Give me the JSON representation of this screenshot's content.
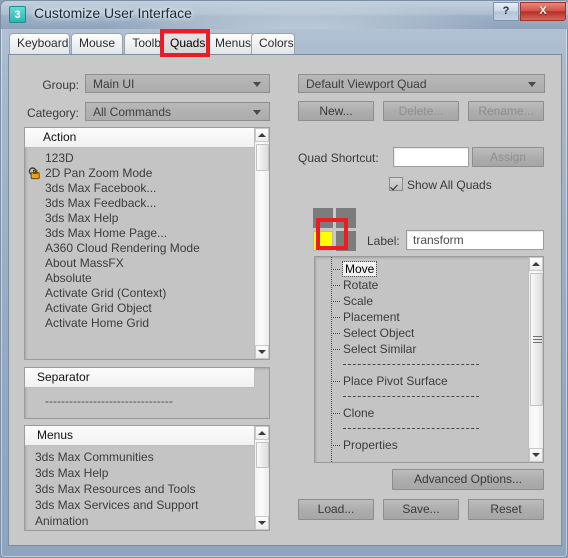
{
  "window": {
    "title": "Customize User Interface",
    "icon": "max-app-icon",
    "icon_glyph": "3",
    "buttons": {
      "help": "?",
      "close": "X"
    }
  },
  "tabs": [
    {
      "label": "Keyboard",
      "active": false
    },
    {
      "label": "Mouse",
      "active": false
    },
    {
      "label": "Toolbars",
      "active": false
    },
    {
      "label": "Quads",
      "active": true
    },
    {
      "label": "Menus",
      "active": false
    },
    {
      "label": "Colors",
      "active": false
    }
  ],
  "left": {
    "group_label": "Group:",
    "group_value": "Main UI",
    "category_label": "Category:",
    "category_value": "All Commands",
    "action_list": {
      "header": "Action",
      "items": [
        {
          "label": "123D",
          "icon": null
        },
        {
          "label": "2D Pan Zoom Mode",
          "icon": "lock-icon"
        },
        {
          "label": "3ds Max Facebook...",
          "icon": null
        },
        {
          "label": "3ds Max Feedback...",
          "icon": null
        },
        {
          "label": "3ds Max Help",
          "icon": null
        },
        {
          "label": "3ds Max Home Page...",
          "icon": null
        },
        {
          "label": "A360 Cloud Rendering Mode",
          "icon": null
        },
        {
          "label": "About MassFX",
          "icon": null
        },
        {
          "label": "Absolute",
          "icon": null
        },
        {
          "label": "Activate Grid (Context)",
          "icon": null
        },
        {
          "label": "Activate Grid Object",
          "icon": null
        },
        {
          "label": "Activate Home Grid",
          "icon": null
        }
      ]
    },
    "separator_list": {
      "header": "Separator",
      "items": [
        {
          "label": "--------------------------------"
        }
      ]
    },
    "menus_list": {
      "header": "Menus",
      "items": [
        {
          "label": "3ds Max Communities"
        },
        {
          "label": "3ds Max Help"
        },
        {
          "label": "3ds Max Resources and Tools"
        },
        {
          "label": "3ds Max Services and Support"
        },
        {
          "label": "Animation"
        }
      ]
    }
  },
  "right": {
    "quad_set_value": "Default Viewport Quad",
    "new_button": "New...",
    "delete_button": "Delete...",
    "rename_button": "Rename...",
    "quad_shortcut_label": "Quad Shortcut:",
    "quad_shortcut_value": "",
    "assign_button": "Assign",
    "show_all_quads_label": "Show All Quads",
    "show_all_quads_checked": true,
    "label_label": "Label:",
    "label_value": "transform",
    "quad_widget": {
      "selected_cell": "bottom-left",
      "selected_color": "#ffff00",
      "cell_color": "#7c7c7c"
    },
    "command_list": [
      {
        "label": "Move",
        "type": "item",
        "selected": true
      },
      {
        "label": "Rotate",
        "type": "item",
        "selected": false
      },
      {
        "label": "Scale",
        "type": "item",
        "selected": false
      },
      {
        "label": "Placement",
        "type": "item",
        "selected": false
      },
      {
        "label": "Select Object",
        "type": "item",
        "selected": false
      },
      {
        "label": "Select Similar",
        "type": "item",
        "selected": false
      },
      {
        "label": "",
        "type": "separator",
        "selected": false
      },
      {
        "label": "Place Pivot Surface",
        "type": "item",
        "selected": false
      },
      {
        "label": "",
        "type": "separator",
        "selected": false
      },
      {
        "label": "Clone",
        "type": "item",
        "selected": false
      },
      {
        "label": "",
        "type": "separator",
        "selected": false
      },
      {
        "label": "Properties",
        "type": "item",
        "selected": false
      }
    ],
    "advanced_options_button": "Advanced Options...",
    "load_button": "Load...",
    "save_button": "Save...",
    "reset_button": "Reset"
  },
  "annotations": {
    "color": "#ed1c24",
    "boxes": [
      {
        "target": "tab-quads"
      },
      {
        "target": "quad-widget-selected-cell"
      }
    ]
  }
}
